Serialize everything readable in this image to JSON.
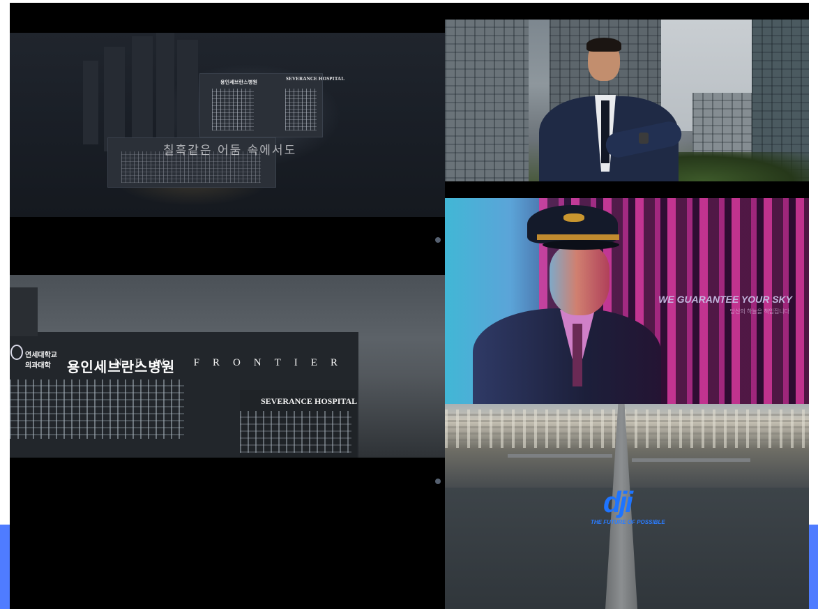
{
  "accent_color": "#4f7cff",
  "frames": {
    "severance_night": {
      "subtitle": "칠흑같은 어둠 속에서도",
      "sign_ko": "용인세브란스병원",
      "sign_en": "SEVERANCE HOSPITAL"
    },
    "severance_day": {
      "university_line1": "연세대학교",
      "university_line2": "의과대학",
      "hospital_ko": "용인세브란스병원",
      "hospital_en": "SEVERANCE HOSPITAL",
      "tagline": "NEW FRONTIER"
    },
    "pilot": {
      "tagline_en": "WE GUARANTEE YOUR SKY",
      "tagline_ko": "당신의 하늘을 책임집니다"
    },
    "dji": {
      "logo": "dji",
      "tagline": "THE FUTURE OF POSSIBLE",
      "logo_color": "#1e74ff"
    }
  }
}
